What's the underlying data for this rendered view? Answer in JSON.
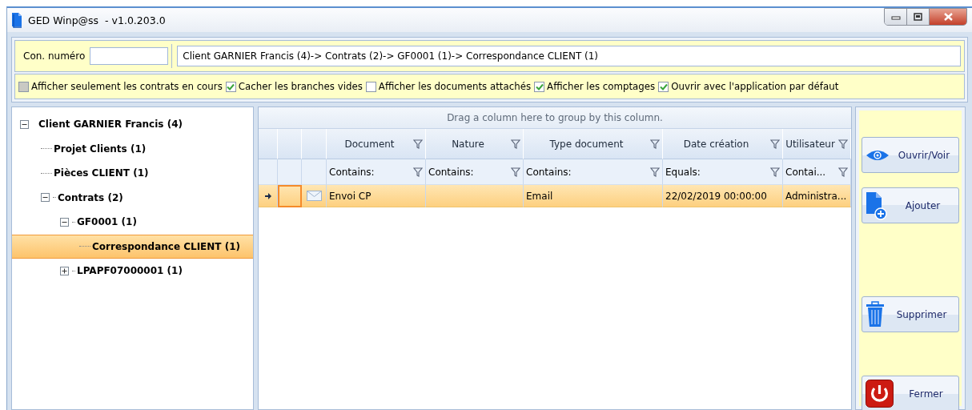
{
  "window": {
    "title": "GED Winp@ss  - v1.0.203.0"
  },
  "search": {
    "label": "Con. numéro",
    "breadcrumb": "Client GARNIER Francis (4)-> Contrats (2)-> GF0001 (1)-> Correspondance CLIENT (1)"
  },
  "options": [
    {
      "label": "Afficher seulement les contrats en cours",
      "checked": false,
      "disabled": true
    },
    {
      "label": "Cacher les branches vides",
      "checked": true,
      "disabled": false
    },
    {
      "label": "Afficher les documents attachés",
      "checked": false,
      "disabled": false
    },
    {
      "label": "Afficher les comptages",
      "checked": true,
      "disabled": false
    },
    {
      "label": "Ouvrir avec l'application par défaut",
      "checked": true,
      "disabled": false
    }
  ],
  "tree": [
    {
      "label": "Client GARNIER Francis (4)",
      "expanded": true,
      "selected": false,
      "children": [
        {
          "label": "Projet Clients (1)",
          "selected": false
        },
        {
          "label": "Pièces CLIENT (1)",
          "selected": false
        },
        {
          "label": "Contrats (2)",
          "expanded": true,
          "selected": false,
          "children": [
            {
              "label": "GF0001 (1)",
              "expanded": true,
              "selected": false,
              "children": [
                {
                  "label": "Correspondance CLIENT (1)",
                  "selected": true
                }
              ]
            },
            {
              "label": "LPAPF07000001 (1)",
              "expanded": false,
              "selected": false
            }
          ]
        }
      ]
    }
  ],
  "grid": {
    "group_hint": "Drag a column here to group by this column.",
    "columns": [
      {
        "label": "Document",
        "filter": "Contains:"
      },
      {
        "label": "Nature",
        "filter": "Contains:"
      },
      {
        "label": "Type document",
        "filter": "Contains:"
      },
      {
        "label": "Date création",
        "filter": "Equals:"
      },
      {
        "label": "Utilisateur",
        "filter": "Contai..."
      }
    ],
    "rows": [
      {
        "selected": true,
        "kind": "mail",
        "cells": [
          "Envoi CP",
          null,
          "Email",
          "22/02/2019 00:00:00",
          "Administra..."
        ]
      }
    ]
  },
  "actions": [
    {
      "label": "Ouvrir/Voir",
      "kind": "view"
    },
    {
      "label": "Ajouter",
      "kind": "add"
    },
    {
      "label": "Supprimer",
      "kind": "delete"
    },
    {
      "label": "Fermer",
      "kind": "close"
    }
  ]
}
